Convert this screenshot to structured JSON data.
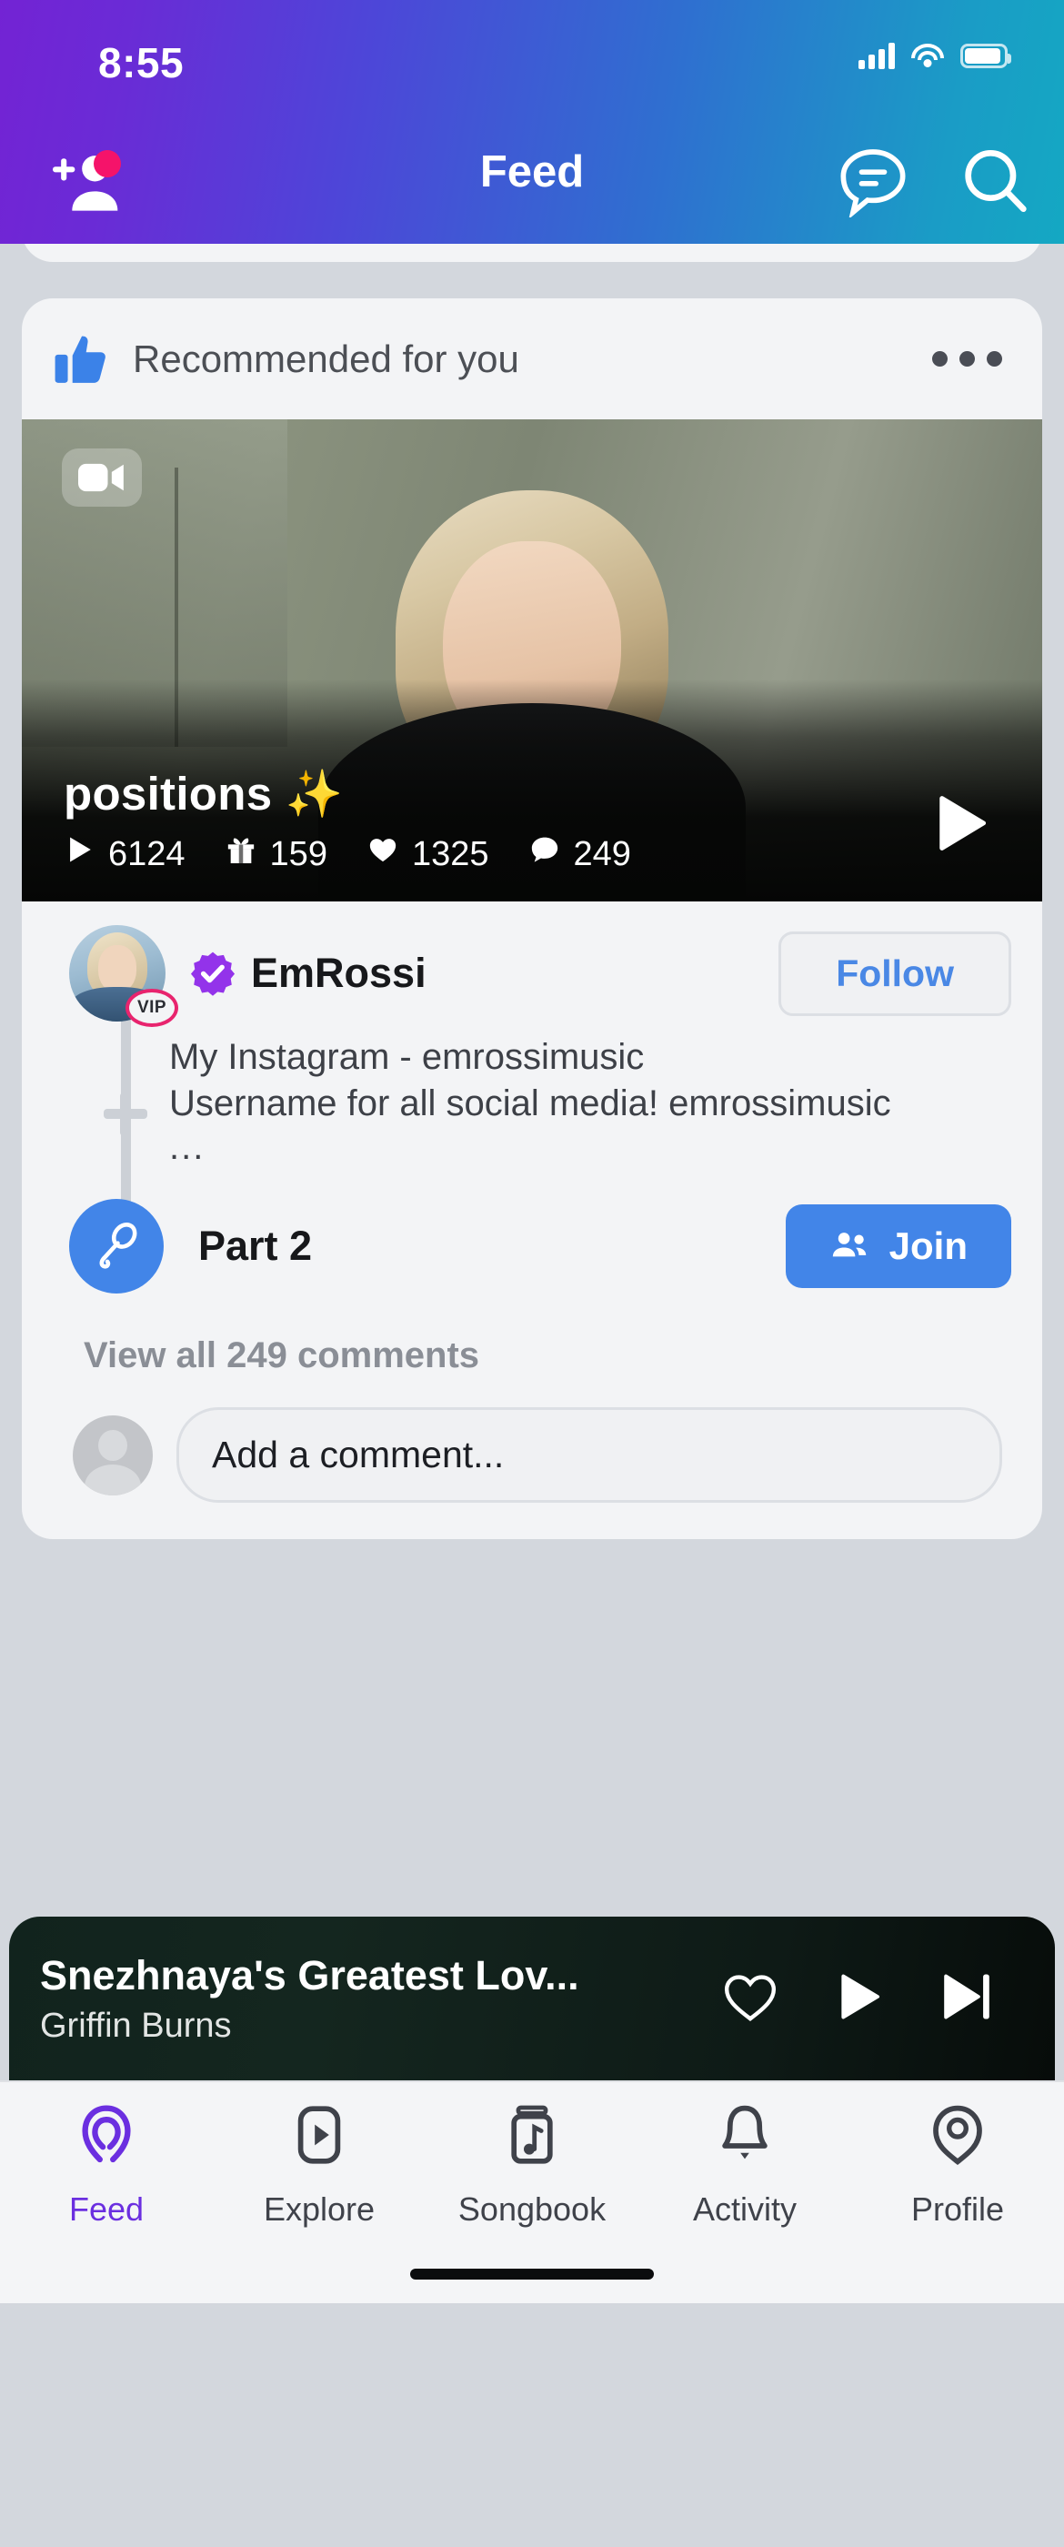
{
  "status_bar": {
    "time": "8:55",
    "icons": [
      "cellular-signal-icon",
      "wifi-icon",
      "battery-icon"
    ]
  },
  "header": {
    "title": "Feed",
    "add_friend_icon": "add-friend-icon",
    "messages_icon": "messages-icon",
    "search_icon": "search-icon",
    "gradient_from": "#7323d4",
    "gradient_to": "#14a8c3"
  },
  "post": {
    "recommend_label": "Recommended for you",
    "recommend_icon": "thumbs-up-icon",
    "thumb_color": "#3b82e8",
    "more_icon": "more-options-icon",
    "video": {
      "badge_icon": "video-camera-icon",
      "title": "positions ✨",
      "play_icon": "play-icon",
      "stats": [
        {
          "icon": "play-icon",
          "value": "6124"
        },
        {
          "icon": "gift-icon",
          "value": "159"
        },
        {
          "icon": "heart-icon",
          "value": "1325"
        },
        {
          "icon": "comment-icon",
          "value": "249"
        }
      ]
    },
    "author": {
      "avatar": "user-avatar",
      "vip_badge": "VIP",
      "vip_color": "#e8246e",
      "verified_icon": "verified-badge-icon",
      "verified_color": "#9333ea",
      "username": "EmRossi",
      "follow_label": "Follow",
      "follow_color": "#4a88e5"
    },
    "description": {
      "line1": "My Instagram - emrossimusic",
      "line2": "Username for all social media! emrossimusic",
      "ellipsis": "..."
    },
    "part": {
      "icon": "microphone-icon",
      "label": "Part 2",
      "join_label": "Join",
      "join_icon": "people-icon",
      "join_color": "#4285e8"
    },
    "view_comments_label": "View all 249 comments",
    "comment_input": {
      "placeholder": "Add a comment...",
      "value": "",
      "avatar": "default-avatar-icon"
    }
  },
  "mini_player": {
    "title": "Snezhnaya's Greatest Lov...",
    "artist": "Griffin Burns",
    "like_icon": "heart-outline-icon",
    "play_icon": "play-icon",
    "next_icon": "skip-next-icon"
  },
  "tab_bar": {
    "active_color": "#6b2fe0",
    "items": [
      {
        "label": "Feed",
        "icon": "feed-icon",
        "active": true
      },
      {
        "label": "Explore",
        "icon": "explore-icon",
        "active": false
      },
      {
        "label": "Songbook",
        "icon": "songbook-icon",
        "active": false
      },
      {
        "label": "Activity",
        "icon": "bell-icon",
        "active": false
      },
      {
        "label": "Profile",
        "icon": "profile-icon",
        "active": false
      }
    ]
  }
}
